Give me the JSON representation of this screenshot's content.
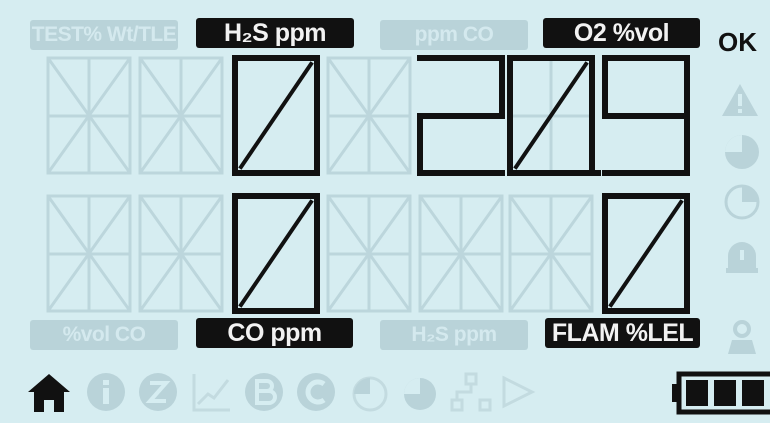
{
  "labels": {
    "top": [
      {
        "text": "TEST% Wt/TLE",
        "active": false
      },
      {
        "text": "H₂S ppm",
        "active": true
      },
      {
        "text": "ppm CO",
        "active": false
      },
      {
        "text": "O2 %vol",
        "active": true
      }
    ],
    "bottom": [
      {
        "text": "%vol CO",
        "active": false
      },
      {
        "text": "CO ppm",
        "active": true
      },
      {
        "text": "H₂S ppm",
        "active": false
      },
      {
        "text": "FLAM %LEL",
        "active": true
      }
    ],
    "status": "OK"
  },
  "readings": {
    "row1_left": "0",
    "row1_right": "20.9",
    "row2_left": "0",
    "row2_right": "0"
  },
  "icons": {
    "right_column": [
      "warning-triangle-icon",
      "pie-3q-icon",
      "pie-1q-icon",
      "alarm-bell-icon",
      "person-icon"
    ],
    "bottom_row": [
      "home-icon",
      "info-icon",
      "zero-icon",
      "graph-icon",
      "bump-icon",
      "calibration-icon",
      "pie-small-icon",
      "pie-large-icon",
      "network-icon",
      "play-icon"
    ],
    "active": [
      "home-icon"
    ],
    "battery_level": "3/3"
  },
  "colors": {
    "background": "#d6edf1",
    "ghost": "#b9d3d9",
    "active": "#111111"
  }
}
